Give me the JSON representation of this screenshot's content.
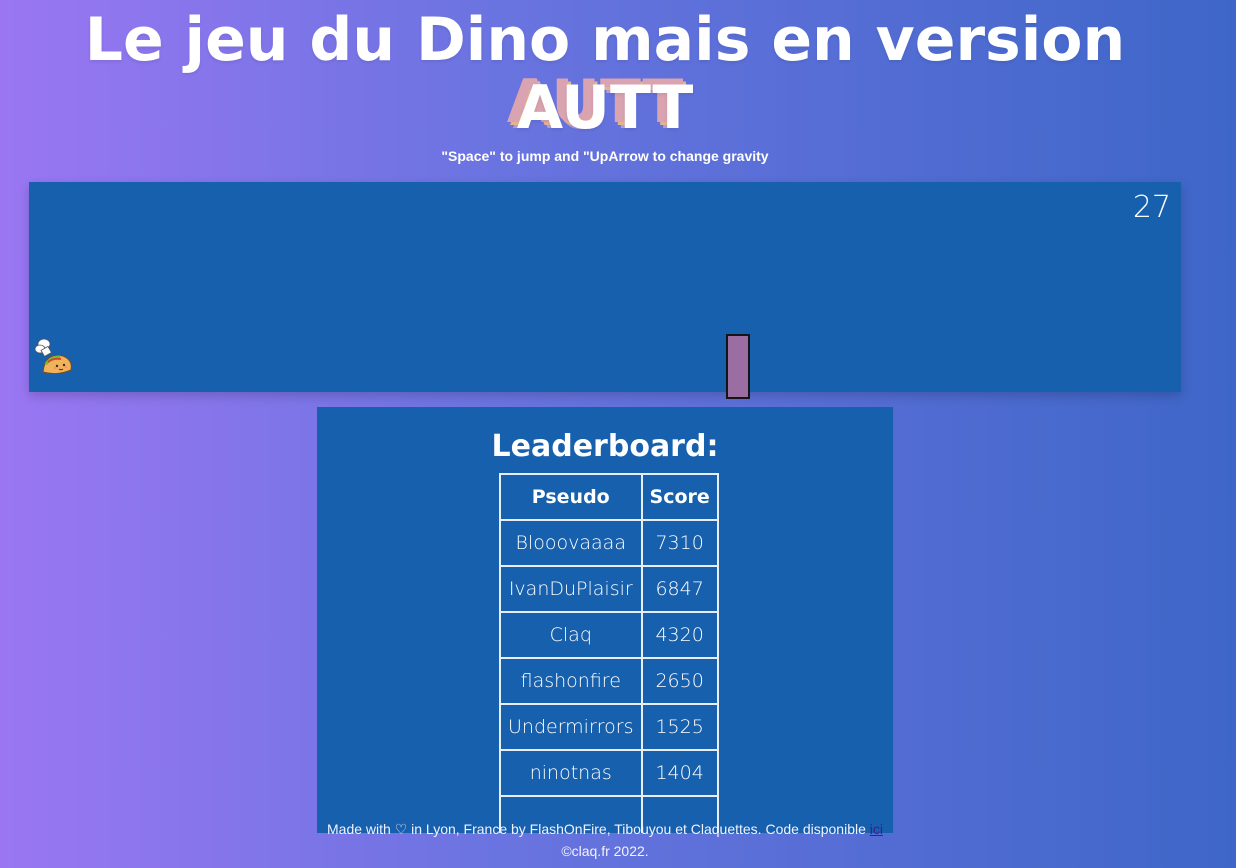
{
  "title": {
    "line1": "Le jeu du Dino mais en version",
    "line2": "AUTT"
  },
  "subtitle": "\"Space\" to jump and \"UpArrow to change gravity",
  "game": {
    "score": "27",
    "player_icon": "taco-chef-icon",
    "obstacle_color": "#9b6ea3",
    "background": "#1760ae"
  },
  "leaderboard": {
    "heading": "Leaderboard:",
    "columns": [
      "Pseudo",
      "Score"
    ],
    "rows": [
      {
        "pseudo": "Blooovaaaa",
        "score": "7310"
      },
      {
        "pseudo": "IvanDuPlaisir",
        "score": "6847"
      },
      {
        "pseudo": "Claq",
        "score": "4320"
      },
      {
        "pseudo": "flashonfire",
        "score": "2650"
      },
      {
        "pseudo": "Undermirrors",
        "score": "1525"
      },
      {
        "pseudo": "ninotnas",
        "score": "1404"
      },
      {
        "pseudo": "",
        "score": ""
      }
    ]
  },
  "footer": {
    "text": "Made with ♡ in Lyon, France by FlashOnFire, Tibouyou et Claquettes. Code disponible ",
    "link": "ici",
    "copyright": "©claq.fr 2022."
  }
}
